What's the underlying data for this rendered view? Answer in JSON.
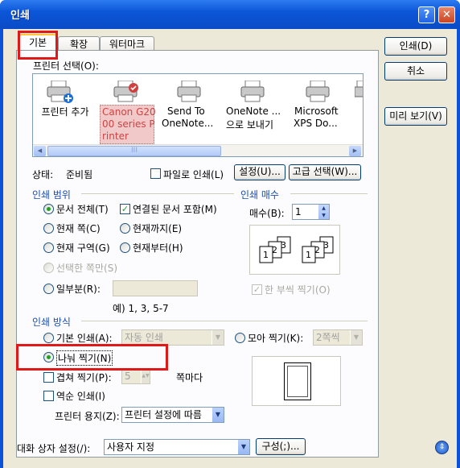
{
  "window": {
    "title": "인쇄",
    "help": "?",
    "close": "✕"
  },
  "tabs": [
    {
      "label": "기본"
    },
    {
      "label": "확장"
    },
    {
      "label": "워터마크"
    }
  ],
  "buttons": {
    "print": "인쇄(D)",
    "cancel": "취소",
    "preview": "미리 보기(V)"
  },
  "printer_section": {
    "label": "프린터 선택(O):",
    "printers": [
      {
        "name": "프린터 추가",
        "icon": "add-printer-icon"
      },
      {
        "name": "Canon G2000 series Printer",
        "lines": [
          "Canon G20",
          "00 series P",
          "rinter"
        ],
        "icon": "printer-icon",
        "selected": true
      },
      {
        "name": "Send To OneNote...",
        "lines": [
          "Send To",
          "OneNote..."
        ],
        "icon": "printer-icon"
      },
      {
        "name": "OneNote ... 으로 보내기",
        "lines": [
          "OneNote ...",
          "으로 보내기"
        ],
        "icon": "printer-icon"
      },
      {
        "name": "Microsoft XPS Do...",
        "lines": [
          "Microsoft",
          "XPS Do..."
        ],
        "icon": "printer-icon"
      }
    ],
    "scroll_thumb": "III"
  },
  "status": {
    "label": "상태:",
    "value": "준비됨",
    "print_to_file": "파일로 인쇄(L)",
    "settings": "설정(U)...",
    "advanced": "고급 선택(W)..."
  },
  "range": {
    "group": "인쇄 범위",
    "all": "문서 전체(T)",
    "include_linked": "연결된 문서 포함(M)",
    "current_page": "현재 쪽(C)",
    "to_current": "현재까지(E)",
    "current_section": "현재 구역(G)",
    "from_current": "현재부터(H)",
    "selected_pages": "선택한 쪽만(S)",
    "partial": "일부분(R):",
    "partial_value": "",
    "example": "예) 1, 3, 5-7"
  },
  "copies": {
    "group": "인쇄 매수",
    "label": "매수(B):",
    "value": "1",
    "collate": "한 부씩 찍기(O)"
  },
  "method": {
    "group": "인쇄 방식",
    "basic": "기본 인쇄(A):",
    "basic_value": "자동 인쇄",
    "collect": "모아 찍기(K):",
    "collect_value": "2쪽씩",
    "split": "나눠 찍기(N)",
    "repeat": "겹쳐 찍기(P):",
    "repeat_value": "5",
    "repeat_unit": "쪽마다",
    "reverse": "역순 인쇄(I)",
    "paper_label": "프린터 용지(Z):",
    "paper_value": "프린터 설정에 따름"
  },
  "footer": {
    "label": "대화 상자 설정(/):",
    "value": "사용자 지정",
    "config": "구성(;)..."
  },
  "colors": {
    "titlebar": "#0b56d8",
    "highlight": "#e01818",
    "selected_printer": "#f2c9c9"
  }
}
